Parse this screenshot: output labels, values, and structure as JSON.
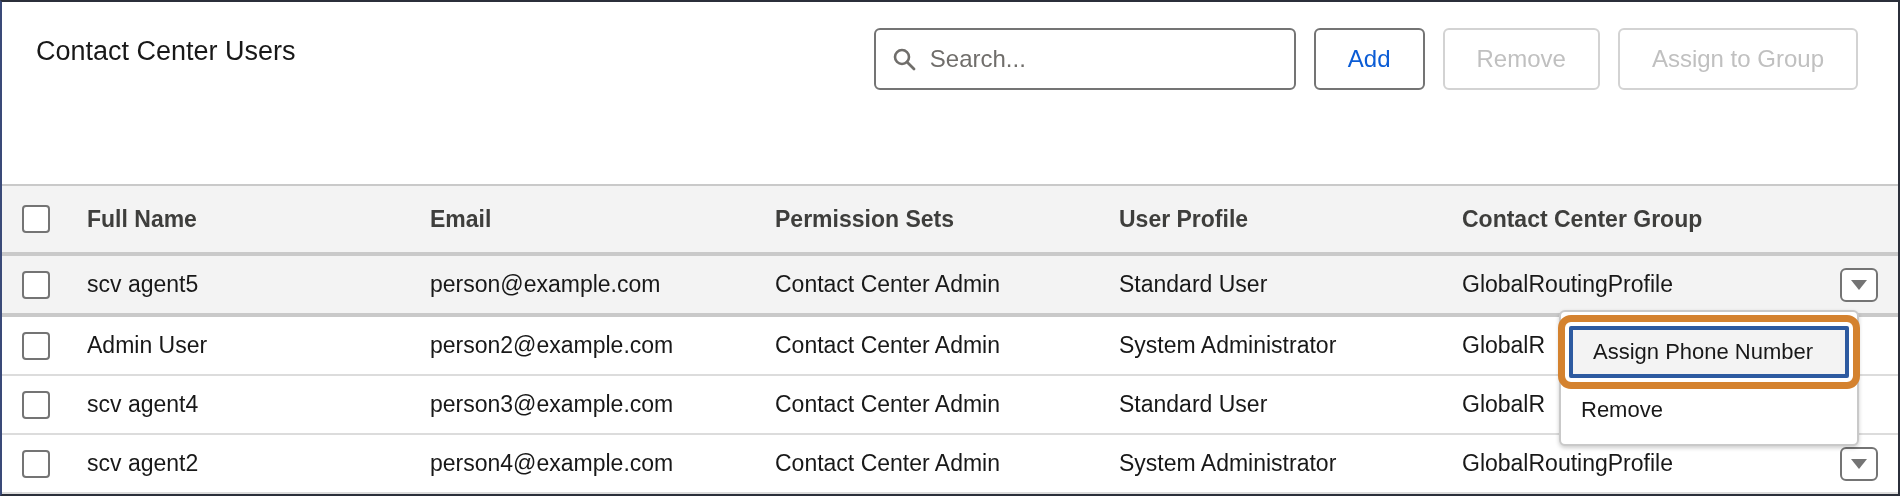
{
  "title": "Contact Center Users",
  "search": {
    "placeholder": "Search..."
  },
  "buttons": [
    {
      "label": "Add",
      "disabled": false
    },
    {
      "label": "Remove",
      "disabled": true
    },
    {
      "label": "Assign to Group",
      "disabled": true
    }
  ],
  "table": {
    "select_all": {
      "checked": false
    },
    "columns": [
      "Full Name",
      "Email",
      "Permission Sets",
      "User Profile",
      "Contact Center Group"
    ],
    "rows": [
      {
        "selected": true,
        "checked": false,
        "action_button": true,
        "cells": [
          "scv agent5",
          "person@example.com",
          "Contact Center Admin",
          "Standard User",
          "GlobalRoutingProfile"
        ]
      },
      {
        "selected": false,
        "checked": false,
        "action_button": false,
        "cells": [
          "Admin User",
          "person2@example.com",
          "Contact Center Admin",
          "System Administrator",
          "GlobalR"
        ]
      },
      {
        "selected": false,
        "checked": false,
        "action_button": false,
        "cells": [
          "scv agent4",
          "person3@example.com",
          "Contact Center Admin",
          "Standard User",
          "GlobalR"
        ]
      },
      {
        "selected": false,
        "checked": false,
        "action_button": true,
        "cells": [
          "scv agent2",
          "person4@example.com",
          "Contact Center Admin",
          "System Administrator",
          "GlobalRoutingProfile"
        ]
      }
    ]
  },
  "row_menu": {
    "items": [
      {
        "label": "Assign Phone Number",
        "highlighted": true
      },
      {
        "label": "Remove",
        "highlighted": false
      }
    ]
  }
}
